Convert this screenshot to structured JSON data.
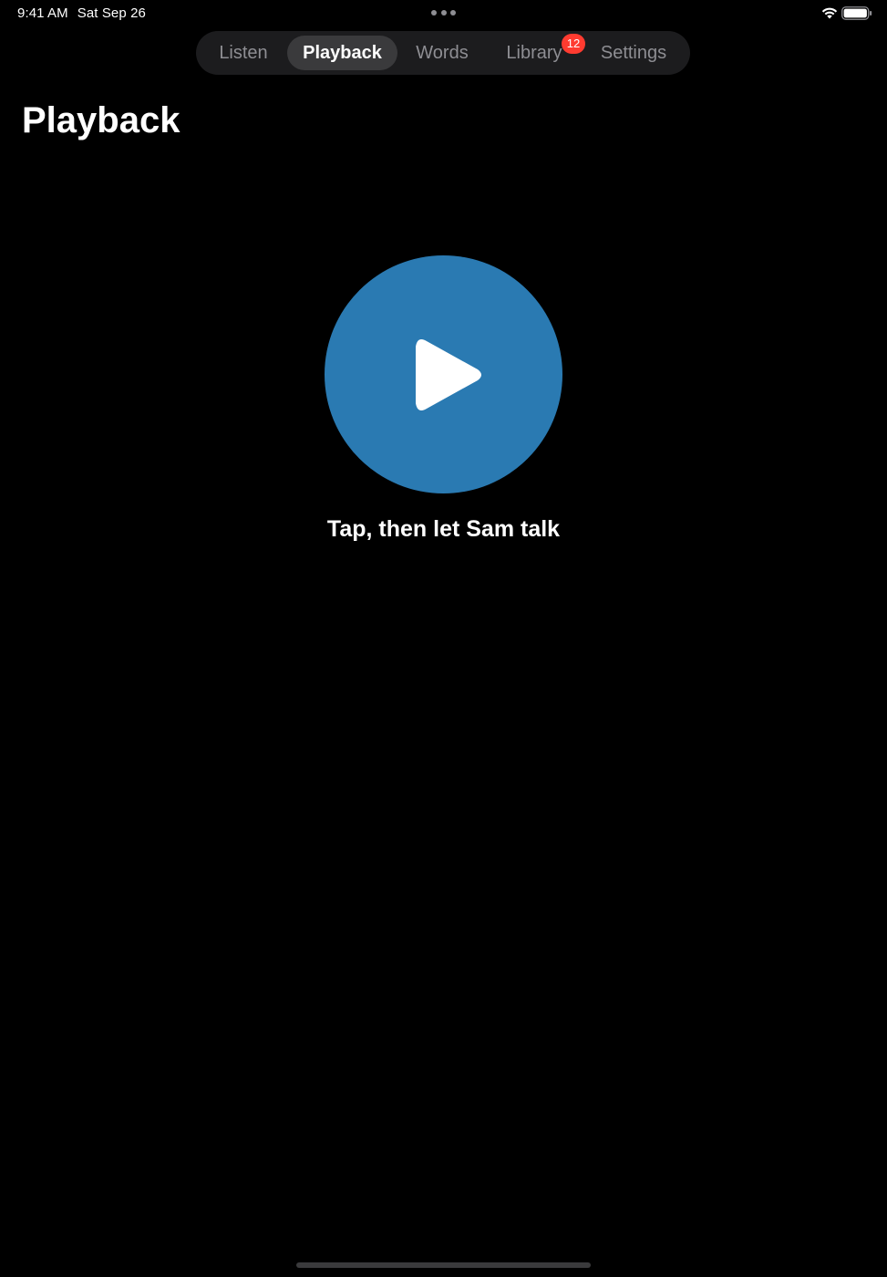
{
  "status_bar": {
    "time": "9:41 AM",
    "date": "Sat Sep 26",
    "icons": [
      "more-dots-icon",
      "wifi-icon",
      "battery-icon"
    ]
  },
  "tabs": [
    {
      "label": "Listen",
      "selected": false
    },
    {
      "label": "Playback",
      "selected": true
    },
    {
      "label": "Words",
      "selected": false
    },
    {
      "label": "Library",
      "selected": false,
      "badge": "12"
    },
    {
      "label": "Settings",
      "selected": false
    }
  ],
  "page": {
    "title": "Playback",
    "play_icon": "play-icon",
    "prompt": "Tap, then let Sam talk"
  },
  "colors": {
    "background": "#000000",
    "play_button": "#2a7ab2",
    "badge": "#ff3b30",
    "segment_bg": "#1c1c1e",
    "segment_selected": "#3a3a3c"
  }
}
